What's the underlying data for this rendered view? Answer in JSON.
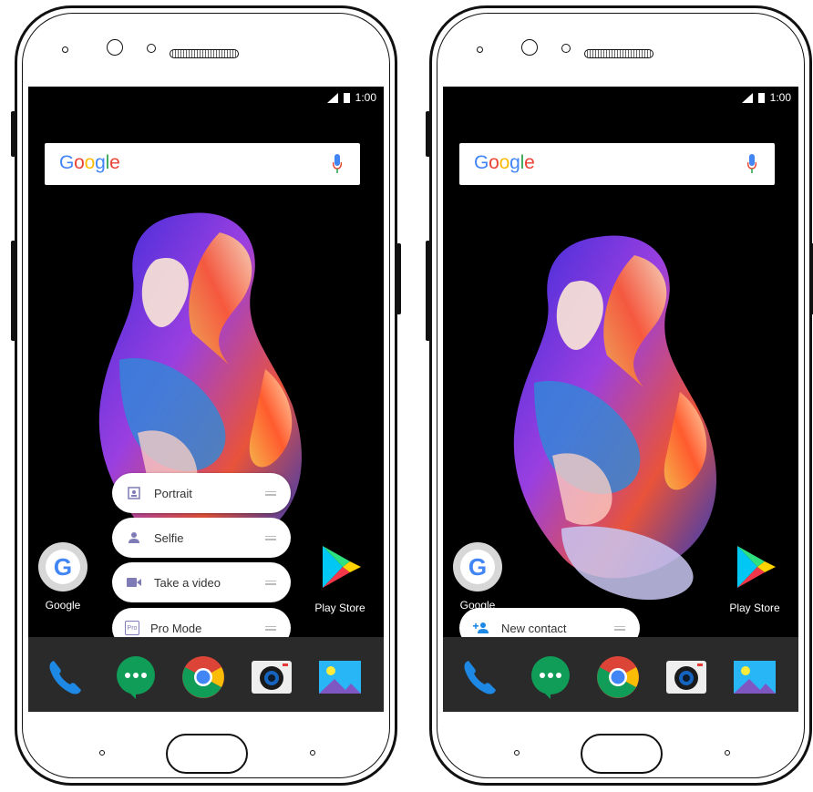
{
  "status_bar": {
    "time": "1:00"
  },
  "search": {
    "logo_text": "Google"
  },
  "apps": {
    "google_label": "Google",
    "play_store_label": "Play Store"
  },
  "left_phone": {
    "shortcuts": [
      {
        "label": "Portrait",
        "icon": "portrait-icon"
      },
      {
        "label": "Selfie",
        "icon": "selfie-icon"
      },
      {
        "label": "Take a video",
        "icon": "video-icon"
      },
      {
        "label": "Pro Mode",
        "icon": "pro-mode-icon",
        "icon_text": "Pro"
      }
    ]
  },
  "right_phone": {
    "shortcuts": [
      {
        "label": "New contact",
        "icon": "add-contact-icon"
      }
    ]
  },
  "colors": {
    "phone_blue": "#1e88e5",
    "hangouts_green": "#0f9d58",
    "shortcut_icon": "#7e7bb6"
  }
}
